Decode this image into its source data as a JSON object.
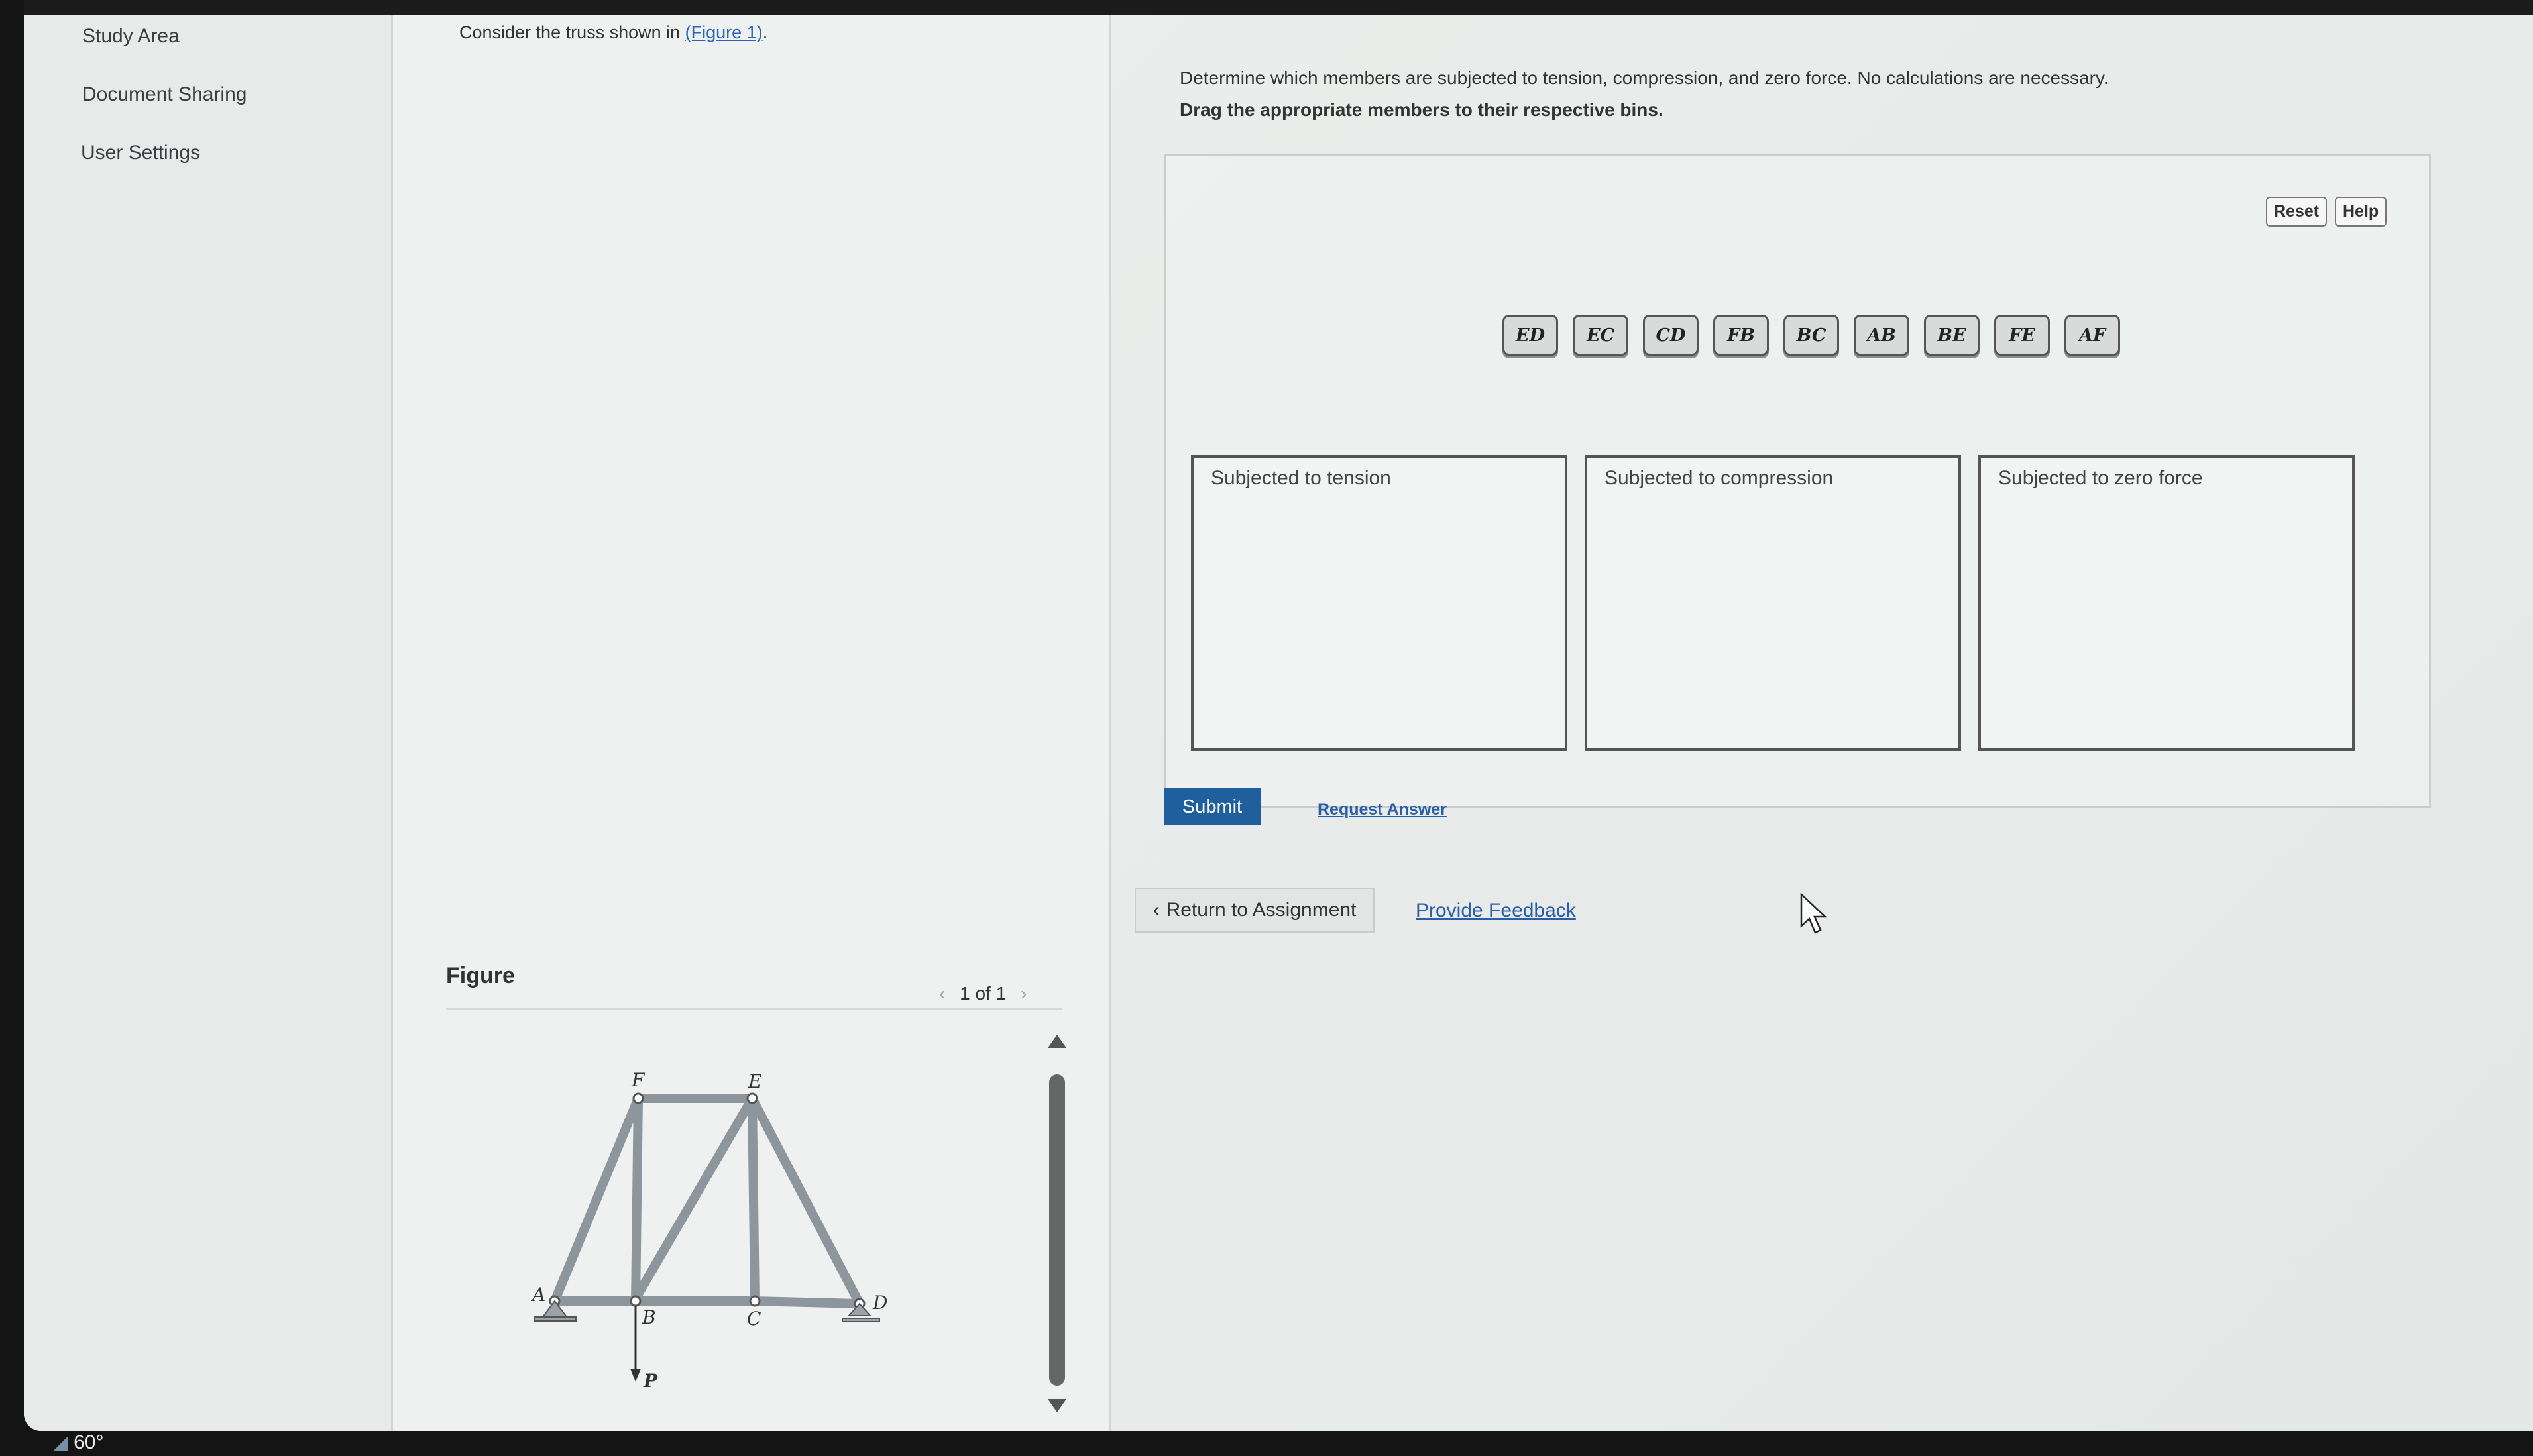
{
  "sidebar": {
    "items": [
      {
        "label": "Study Area"
      },
      {
        "label": "Document Sharing"
      },
      {
        "label": "User Settings"
      }
    ]
  },
  "problem": {
    "intro_prefix": "Consider the truss shown in ",
    "figure_link": "(Figure 1)",
    "intro_suffix": "."
  },
  "figure": {
    "heading": "Figure",
    "page": "1 of 1",
    "prev_icon": "chevron-left",
    "next_icon": "chevron-right",
    "joint_labels": {
      "A": "A",
      "B": "B",
      "C": "C",
      "D": "D",
      "E": "E",
      "F": "F"
    },
    "load_label": "P"
  },
  "question": {
    "text": "Determine which members are subjected to tension, compression, and zero force. No calculations are necessary.",
    "instruction": "Drag the appropriate members to their respective bins."
  },
  "toolbar": {
    "reset_label": "Reset",
    "help_label": "Help"
  },
  "tokens": [
    "ED",
    "EC",
    "CD",
    "FB",
    "BC",
    "AB",
    "BE",
    "FE",
    "AF"
  ],
  "bins": [
    {
      "label": "Subjected to tension"
    },
    {
      "label": "Subjected to compression"
    },
    {
      "label": "Subjected to zero force"
    }
  ],
  "actions": {
    "submit_label": "Submit",
    "request_answer_label": "Request Answer",
    "return_label": "Return to Assignment",
    "feedback_label": "Provide Feedback"
  },
  "status": {
    "temperature": "60°"
  },
  "colors": {
    "submit_bg": "#1f5f9e",
    "link": "#2a5fa8"
  }
}
